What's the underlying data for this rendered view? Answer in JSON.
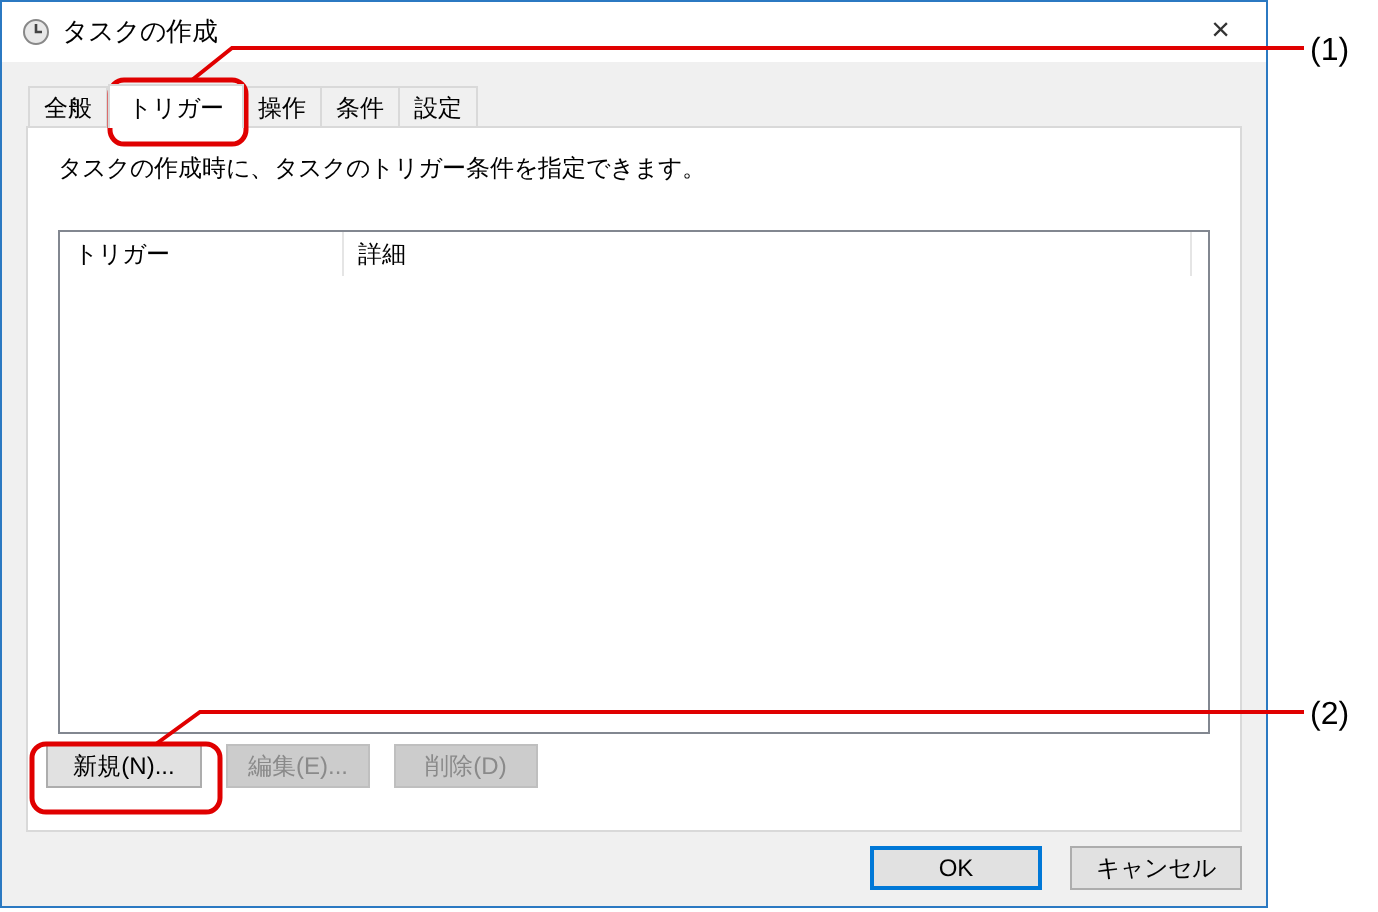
{
  "window": {
    "title": "タスクの作成",
    "close": "×"
  },
  "tabs": [
    {
      "label": "全般",
      "selected": false
    },
    {
      "label": "トリガー",
      "selected": true
    },
    {
      "label": "操作",
      "selected": false
    },
    {
      "label": "条件",
      "selected": false
    },
    {
      "label": "設定",
      "selected": false
    }
  ],
  "description": "タスクの作成時に、タスクのトリガー条件を指定できます。",
  "list": {
    "columns": [
      "トリガー",
      "詳細"
    ]
  },
  "list_buttons": [
    {
      "label": "新規(N)...",
      "disabled": false
    },
    {
      "label": "編集(E)...",
      "disabled": true
    },
    {
      "label": "削除(D)",
      "disabled": true
    }
  ],
  "dialog_buttons": [
    {
      "label": "OK",
      "default": true
    },
    {
      "label": "キャンセル",
      "default": false
    }
  ],
  "annotations": [
    {
      "label": "(1)"
    },
    {
      "label": "(2)"
    }
  ]
}
